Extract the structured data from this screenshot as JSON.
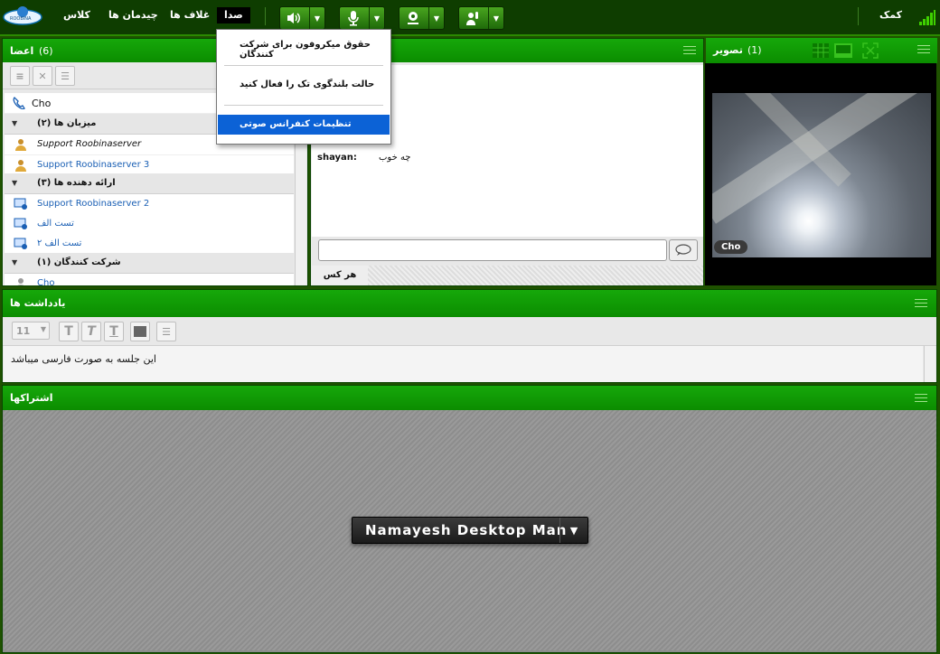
{
  "topbar": {
    "menu": [
      "کلاس",
      "چیدمان ها",
      "غلاف ها",
      "صدا"
    ],
    "help": "کمک"
  },
  "audio_menu": {
    "items": [
      "حقوق میکروفون برای شرکت کنندگان",
      "حالت بلندگوی تک را فعال کنید",
      "تنظیمات کنفرانس صوتی"
    ],
    "selected_index": 2
  },
  "members": {
    "title": "اعضا",
    "count": "(6)",
    "me": "Cho",
    "groups": [
      {
        "label": "(میزبان ها (۲",
        "items": [
          "Support Roobinaserver",
          "Support Roobinaserver 3"
        ]
      },
      {
        "label": "(ارائه دهنده ها (۳",
        "items": [
          "Support Roobinaserver 2",
          "تست الف",
          "تست الف ۲"
        ]
      },
      {
        "label": "(شرکت کنندگان (۱",
        "items": [
          "Cho"
        ]
      }
    ]
  },
  "chat": {
    "message_user": "shayan:",
    "message_text": "چه خوب",
    "tab_label": "هر کس"
  },
  "video": {
    "title": "تصویر",
    "count": "(1)",
    "label": "Cho"
  },
  "notes": {
    "title": "یادداشت ها",
    "font_size": "11",
    "text": "این جلسه به صورت فارسی میباشد"
  },
  "sharing": {
    "title": "اشتراکها",
    "desktop_button": "Namayesh Desktop Man"
  },
  "colors": {
    "header_green": "#0b8d00",
    "topbar_bg": "#0e3d00",
    "selected_menu_blue": "#0c62d6"
  }
}
